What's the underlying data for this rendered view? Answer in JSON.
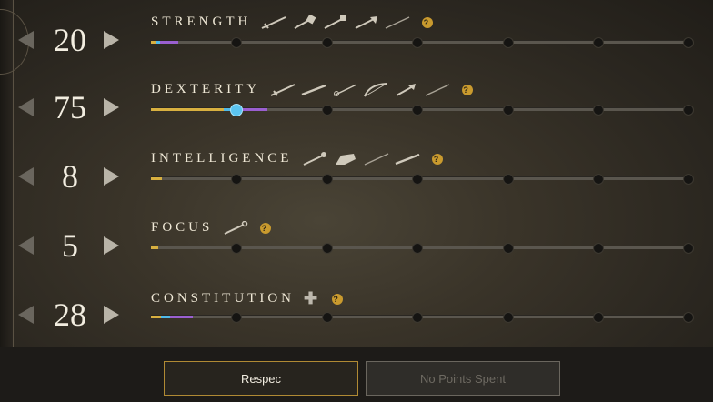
{
  "attributes": [
    {
      "key": "strength",
      "name": "STRENGTH",
      "value": "20",
      "icons": [
        "sword-icon",
        "hammer-icon",
        "warhammer-icon",
        "great-axe-icon",
        "spear-icon"
      ],
      "has_plus": false,
      "bars": {
        "gold": 1.0,
        "blue": 0.7,
        "purple": 3.4
      },
      "handle": null
    },
    {
      "key": "dexterity",
      "name": "DEXTERITY",
      "value": "75",
      "icons": [
        "sword-icon",
        "musket-icon",
        "rapier-icon",
        "bow-icon",
        "hatchet-icon",
        "spear-icon"
      ],
      "has_plus": false,
      "bars": {
        "gold": 13.5,
        "blue": 1.5,
        "purple": 6.5
      },
      "handle": 15.7
    },
    {
      "key": "intelligence",
      "name": "INTELLIGENCE",
      "value": "8",
      "icons": [
        "fire-staff-icon",
        "ice-gauntlet-icon",
        "spear-icon",
        "musket-icon"
      ],
      "has_plus": false,
      "bars": {
        "gold": 2.0,
        "blue": 0,
        "purple": 0
      },
      "handle": null
    },
    {
      "key": "focus",
      "name": "FOCUS",
      "value": "5",
      "icons": [
        "life-staff-icon"
      ],
      "has_plus": false,
      "bars": {
        "gold": 1.3,
        "blue": 0,
        "purple": 0
      },
      "handle": null
    },
    {
      "key": "constitution",
      "name": "CONSTITUTION",
      "value": "28",
      "icons": [],
      "has_plus": true,
      "bars": {
        "gold": 1.8,
        "blue": 1.7,
        "purple": 4.3
      },
      "handle": null
    }
  ],
  "footer": {
    "respec_label": "Respec",
    "spent_label": "No Points Spent"
  },
  "colors": {
    "gold": "#d8b040",
    "blue": "#4fb9e8",
    "purple": "#9a5fd0",
    "accent": "#b08a34"
  }
}
